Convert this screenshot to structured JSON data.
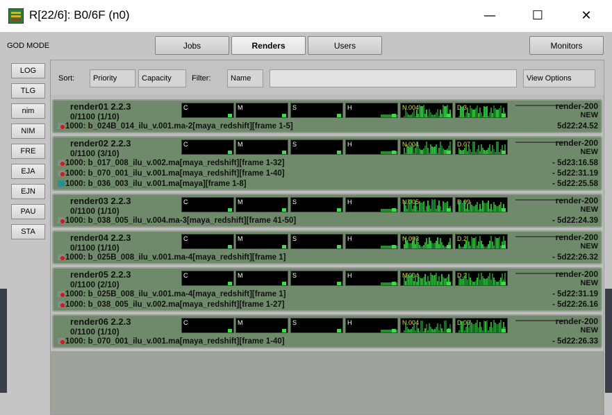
{
  "window": {
    "title": "R[22/6]: B0/6F (n0)",
    "minimize": "—",
    "maximize": "☐",
    "close": "✕",
    "icon": "render-farm-app-icon"
  },
  "header": {
    "mode_label": "GOD MODE",
    "tabs": [
      "Jobs",
      "Renders",
      "Users"
    ],
    "active_tab": "Renders",
    "monitors_label": "Monitors"
  },
  "sidebar": {
    "items": [
      "LOG",
      "TLG",
      "nim",
      "NIM",
      "FRE",
      "EJA",
      "EJN",
      "PAU",
      "STA"
    ]
  },
  "toolbar": {
    "sort_label": "Sort:",
    "sort_priority": "Priority",
    "sort_capacity": "Capacity",
    "filter_label": "Filter:",
    "filter_name": "Name",
    "filter_value": "",
    "view_options": "View Options"
  },
  "colors": {
    "card_background": "#6f8a6a",
    "graph_background": "#000000",
    "graph_green": "#2bc13a"
  },
  "renders": [
    {
      "name": "render01 2.2.3",
      "capacity": "0/1100 (1/10)",
      "host": "render-200",
      "state": "NEW",
      "graphs": [
        "C",
        "M",
        "S",
        "H",
        "N.004",
        "D.3"
      ],
      "tasks": [
        {
          "text": "1000: b_024B_014_ilu_v.001.ma-2[maya_redshift][frame 1-5]",
          "time": "5d22:24.52",
          "icon": "red-dot-task-icon"
        }
      ]
    },
    {
      "name": "render02 2.2.3",
      "capacity": "0/1100 (3/10)",
      "host": "render-200",
      "state": "NEW",
      "graphs": [
        "C",
        "M",
        "S",
        "H",
        "N.004",
        "D.07"
      ],
      "tasks": [
        {
          "text": "1000: b_017_008_ilu_v.002.ma[maya_redshift][frame 1-32]",
          "time": "- 5d23:16.58",
          "icon": "red-dot-task-icon"
        },
        {
          "text": "1000: b_070_001_ilu_v.001.ma[maya_redshift][frame 1-40]",
          "time": "- 5d22:31.19",
          "icon": "red-dot-task-icon"
        },
        {
          "text": "1000: b_036_003_ilu_v.001.ma[maya][frame 1-8]",
          "time": "- 5d22:25.58",
          "icon": "maya-task-icon"
        }
      ]
    },
    {
      "name": "render03 2.2.3",
      "capacity": "0/1100 (1/10)",
      "host": "render-200",
      "state": "NEW",
      "graphs": [
        "C",
        "M",
        "S",
        "H",
        "N.005",
        "D.09"
      ],
      "tasks": [
        {
          "text": "1000: b_038_005_ilu_v.004.ma-3[maya_redshift][frame 41-50]",
          "time": "- 5d22:24.39",
          "icon": "red-dot-task-icon"
        }
      ]
    },
    {
      "name": "render04 2.2.3",
      "capacity": "0/1100 (1/10)",
      "host": "render-200",
      "state": "NEW",
      "graphs": [
        "C",
        "M",
        "S",
        "H",
        "N.003",
        "D.2"
      ],
      "tasks": [
        {
          "text": "1000: b_025B_008_ilu_v.001.ma-4[maya_redshift][frame 1]",
          "time": "- 5d22:26.32",
          "icon": "red-dot-task-icon"
        }
      ]
    },
    {
      "name": "render05 2.2.3",
      "capacity": "0/1100 (2/10)",
      "host": "render-200",
      "state": "NEW",
      "graphs": [
        "C",
        "M",
        "S",
        "H",
        "N.004",
        "D.2"
      ],
      "tasks": [
        {
          "text": "1000: b_025B_008_ilu_v.001.ma-4[maya_redshift][frame 1]",
          "time": "- 5d22:31.19",
          "icon": "red-dot-task-icon"
        },
        {
          "text": "1000: b_038_005_ilu_v.002.ma[maya_redshift][frame 1-27]",
          "time": "- 5d22:26.16",
          "icon": "red-dot-task-icon"
        }
      ]
    },
    {
      "name": "render06 2.2.3",
      "capacity": "0/1100 (1/10)",
      "host": "render-200",
      "state": "NEW",
      "graphs": [
        "C",
        "M",
        "S",
        "H",
        "N.004",
        "D.09"
      ],
      "tasks": [
        {
          "text": "1000: b_070_001_ilu_v.001.ma[maya_redshift][frame 1-40]",
          "time": "- 5d22:26.33",
          "icon": "red-dot-task-icon"
        }
      ]
    }
  ]
}
